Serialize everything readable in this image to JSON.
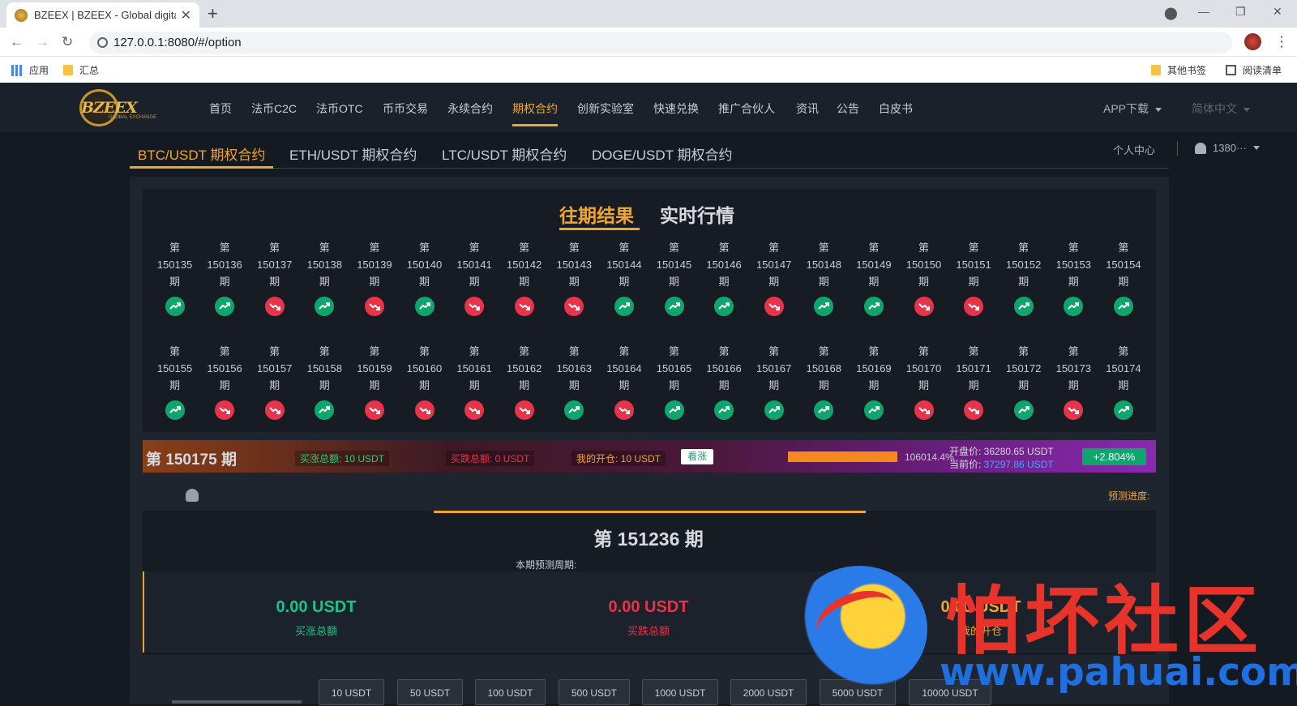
{
  "browser": {
    "tab_title": "BZEEX | BZEEX - Global digita",
    "url": "127.0.0.1:8080/#/option",
    "bookmarks": {
      "apps": "应用",
      "folder": "汇总",
      "other": "其他书签",
      "reading": "阅读清单"
    }
  },
  "site": {
    "logo": "BZEEX",
    "logo_sub": "GLOBAL EXCHANGE",
    "menu": [
      "首页",
      "法币C2C",
      "法币OTC",
      "币币交易",
      "永续合约",
      "期权合约",
      "创新实验室",
      "快速兑换",
      "推广合伙人",
      "资讯",
      "公告",
      "白皮书"
    ],
    "active_menu": "期权合约",
    "app_download": "APP下载",
    "language": "简体中文"
  },
  "pairs": {
    "tabs": [
      "BTC/USDT 期权合约",
      "ETH/USDT 期权合约",
      "LTC/USDT 期权合约",
      "DOGE/USDT 期权合约"
    ],
    "active": "BTC/USDT 期权合约",
    "user_center": "个人中心",
    "user": "1380···"
  },
  "history": {
    "tabs": [
      "往期结果",
      "实时行情"
    ],
    "prefix": "第",
    "suffix": "期",
    "periods": [
      {
        "id": "150135",
        "dir": "up"
      },
      {
        "id": "150136",
        "dir": "up"
      },
      {
        "id": "150137",
        "dir": "down"
      },
      {
        "id": "150138",
        "dir": "up"
      },
      {
        "id": "150139",
        "dir": "down"
      },
      {
        "id": "150140",
        "dir": "up"
      },
      {
        "id": "150141",
        "dir": "down"
      },
      {
        "id": "150142",
        "dir": "down"
      },
      {
        "id": "150143",
        "dir": "down"
      },
      {
        "id": "150144",
        "dir": "up"
      },
      {
        "id": "150145",
        "dir": "up"
      },
      {
        "id": "150146",
        "dir": "up"
      },
      {
        "id": "150147",
        "dir": "down"
      },
      {
        "id": "150148",
        "dir": "up"
      },
      {
        "id": "150149",
        "dir": "up"
      },
      {
        "id": "150150",
        "dir": "down"
      },
      {
        "id": "150151",
        "dir": "down"
      },
      {
        "id": "150152",
        "dir": "up"
      },
      {
        "id": "150153",
        "dir": "up"
      },
      {
        "id": "150154",
        "dir": "up"
      },
      {
        "id": "150155",
        "dir": "up"
      },
      {
        "id": "150156",
        "dir": "down"
      },
      {
        "id": "150157",
        "dir": "down"
      },
      {
        "id": "150158",
        "dir": "up"
      },
      {
        "id": "150159",
        "dir": "down"
      },
      {
        "id": "150160",
        "dir": "down"
      },
      {
        "id": "150161",
        "dir": "down"
      },
      {
        "id": "150162",
        "dir": "down"
      },
      {
        "id": "150163",
        "dir": "up"
      },
      {
        "id": "150164",
        "dir": "down"
      },
      {
        "id": "150165",
        "dir": "up"
      },
      {
        "id": "150166",
        "dir": "up"
      },
      {
        "id": "150167",
        "dir": "up"
      },
      {
        "id": "150168",
        "dir": "up"
      },
      {
        "id": "150169",
        "dir": "up"
      },
      {
        "id": "150170",
        "dir": "down"
      },
      {
        "id": "150171",
        "dir": "down"
      },
      {
        "id": "150172",
        "dir": "up"
      },
      {
        "id": "150173",
        "dir": "down"
      },
      {
        "id": "150174",
        "dir": "up"
      }
    ]
  },
  "status": {
    "period": "第 150175 期",
    "total_up": "买涨总额: 10 USDT",
    "total_down": "买跌总额: 0 USDT",
    "my_position": "我的开仓: 10 USDT",
    "bull_label": "看涨",
    "progress_pct": "106014.4%",
    "open_price": "开盘价: 36280.65 USDT",
    "current_label": "当前价: ",
    "current_price": "37297.86 USDT",
    "change": "+2.804%"
  },
  "predict_label": "预测进度:",
  "round": {
    "title": "第 151236 期",
    "cycle_label": "本期预测周期:",
    "up_amount": "0.00 USDT",
    "up_label": "买涨总额",
    "down_amount": "0.00 USDT",
    "down_label": "买跌总额",
    "mine_amount": "0.00 USDT",
    "mine_label": "我的开仓"
  },
  "bets": [
    "10 USDT",
    "50 USDT",
    "100 USDT",
    "500 USDT",
    "1000 USDT",
    "2000 USDT",
    "5000 USDT",
    "10000 USDT"
  ],
  "watermark": {
    "text": "怕坏社区",
    "url": "www.pahuai.com"
  },
  "colors": {
    "accent": "#f0a62c",
    "up": "#0fa66e",
    "down": "#e8334a"
  }
}
